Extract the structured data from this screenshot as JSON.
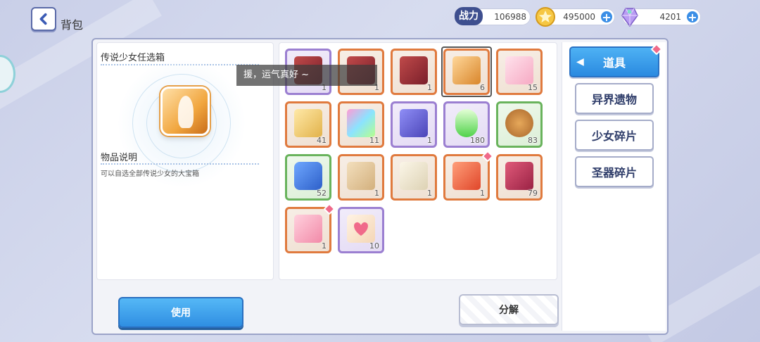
{
  "header": {
    "title": "背包",
    "power_label": "战力",
    "power_value": "106988",
    "coins": "495000",
    "gems": "4201"
  },
  "detail": {
    "item_name": "传说少女任选箱",
    "desc_heading": "物品说明",
    "desc_text": "可以自选全部传说少女的大宝箱"
  },
  "tooltip": "援，运气真好 ~",
  "inventory": {
    "counts": [
      "1",
      "1",
      "1",
      "6",
      "15",
      "41",
      "11",
      "1",
      "180",
      "83",
      "52",
      "1",
      "1",
      "1",
      "79",
      "1",
      "10"
    ]
  },
  "tabs": {
    "items": "道具",
    "relics": "异界遗物",
    "girl_shards": "少女碎片",
    "artifact_shards": "圣器碎片"
  },
  "actions": {
    "use": "使用",
    "decompose": "分解"
  },
  "colors": {
    "accent_blue": "#2f8ee2",
    "rarity_orange": "#e07a3e",
    "rarity_purple": "#9b7fd1",
    "rarity_green": "#69b35c",
    "new_badge": "#f06a8a"
  },
  "icons": {
    "back": "chevron-left-icon",
    "coin": "star-coin-icon",
    "gem": "crystal-icon",
    "plus": "plus-icon"
  }
}
